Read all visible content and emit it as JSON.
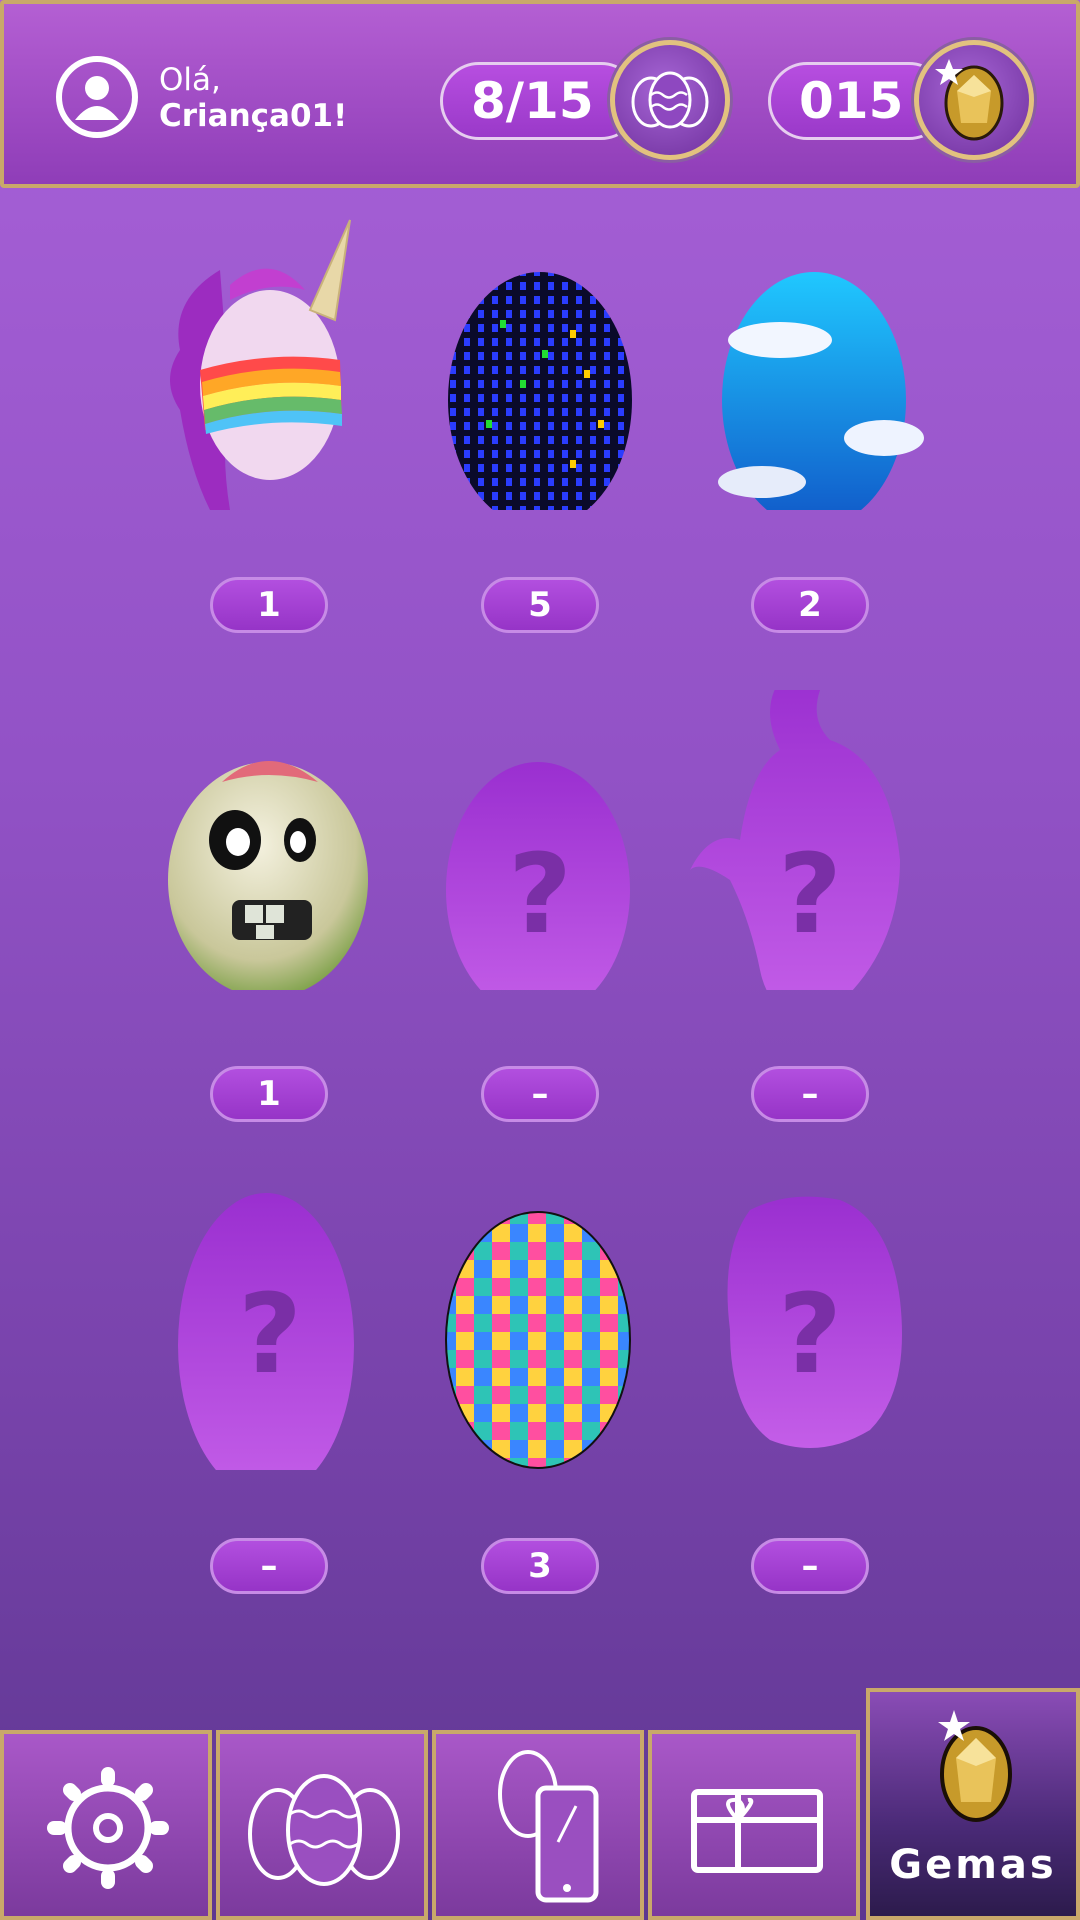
{
  "header": {
    "greeting_line1": "Olá,",
    "greeting_line2": "Criança01!",
    "eggs_collected": "8/15",
    "gems_count": "015"
  },
  "eggs": [
    {
      "name": "unicorn-egg",
      "count": "1",
      "unlocked": true
    },
    {
      "name": "disco-lights-egg",
      "count": "5",
      "unlocked": true
    },
    {
      "name": "sky-clouds-egg",
      "count": "2",
      "unlocked": true
    },
    {
      "name": "zombie-egg",
      "count": "1",
      "unlocked": true
    },
    {
      "name": "locked-egg",
      "count": "–",
      "unlocked": false,
      "symbol": "?"
    },
    {
      "name": "locked-egg",
      "count": "–",
      "unlocked": false,
      "symbol": "?"
    },
    {
      "name": "locked-egg",
      "count": "–",
      "unlocked": false,
      "symbol": "?"
    },
    {
      "name": "mosaic-egg",
      "count": "3",
      "unlocked": true
    },
    {
      "name": "locked-egg",
      "count": "–",
      "unlocked": false,
      "symbol": "?"
    }
  ],
  "nav": {
    "items": [
      {
        "icon": "gear-icon"
      },
      {
        "icon": "eggs-collection-icon"
      },
      {
        "icon": "egg-phone-icon"
      },
      {
        "icon": "gift-card-icon"
      }
    ],
    "active_label": "Gemas",
    "active_icon": "gem-egg-icon"
  },
  "colors": {
    "background": "#9252c6",
    "gold_border": "#c9a86a",
    "pill": "#9a39c9"
  }
}
